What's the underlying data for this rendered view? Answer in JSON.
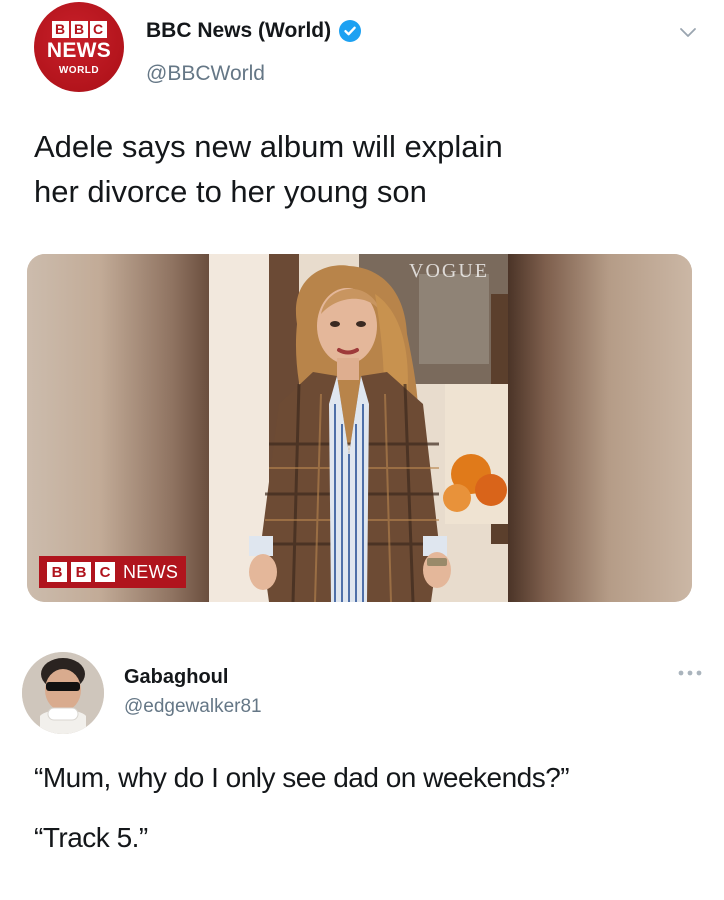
{
  "tweet": {
    "avatar": {
      "blocks": [
        "B",
        "B",
        "C"
      ],
      "news": "NEWS",
      "world": "WORLD"
    },
    "display_name": "BBC News (World)",
    "handle": "@BBCWorld",
    "text_line_1": "Adele says new album will explain",
    "text_line_2": "her divorce to her young son",
    "media": {
      "magazine_mark": "VOGUE",
      "logo_blocks": [
        "B",
        "B",
        "C"
      ],
      "logo_news": "NEWS"
    }
  },
  "reply": {
    "display_name": "Gabaghoul",
    "handle": "@edgewalker81",
    "line_1": "“Mum, why do I only see dad on weekends?”",
    "line_2": "“Track 5.”"
  },
  "colors": {
    "bbc_red": "#b3141c",
    "verified_blue": "#1da1f2",
    "handle_grey": "#657786",
    "text": "#14171a"
  },
  "icons": {
    "verified": "verified-badge-icon",
    "menu": "chevron-down-icon",
    "more": "more-horizontal-icon"
  }
}
